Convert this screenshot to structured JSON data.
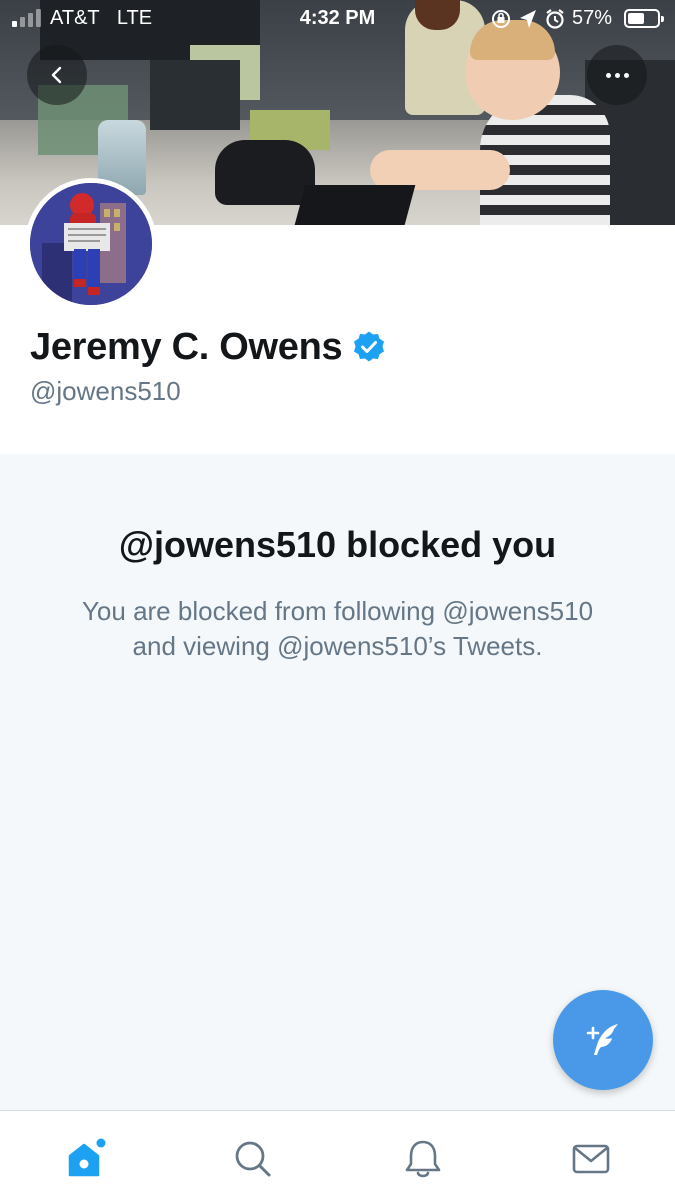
{
  "status_bar": {
    "carrier": "AT&T",
    "network": "LTE",
    "time": "4:32 PM",
    "battery_percent": "57%",
    "battery_level": 0.57,
    "signal_bars_filled": 1,
    "signal_bars_total": 4
  },
  "profile": {
    "display_name": "Jeremy C. Owens",
    "handle": "@jowens510",
    "verified": true
  },
  "blocked": {
    "title": "@jowens510 blocked you",
    "message": "You are blocked from following @jowens510 and viewing @jowens510’s Tweets."
  },
  "icons": {
    "back": "chevron-left-icon",
    "more": "more-horizontal-icon",
    "compose": "compose-tweet-icon",
    "home": "home-icon",
    "search": "search-icon",
    "notifications": "bell-icon",
    "messages": "mail-icon",
    "verified": "verified-badge-icon"
  },
  "colors": {
    "accent": "#1da1f2",
    "fab": "#4a99e9",
    "verified": "#1da1f2",
    "secondary_text": "#657786",
    "primary_text": "#14171a",
    "panel_background": "#f5f8fa",
    "tab_icon": "#657786"
  },
  "tab_bar": {
    "active_tab": "home"
  }
}
